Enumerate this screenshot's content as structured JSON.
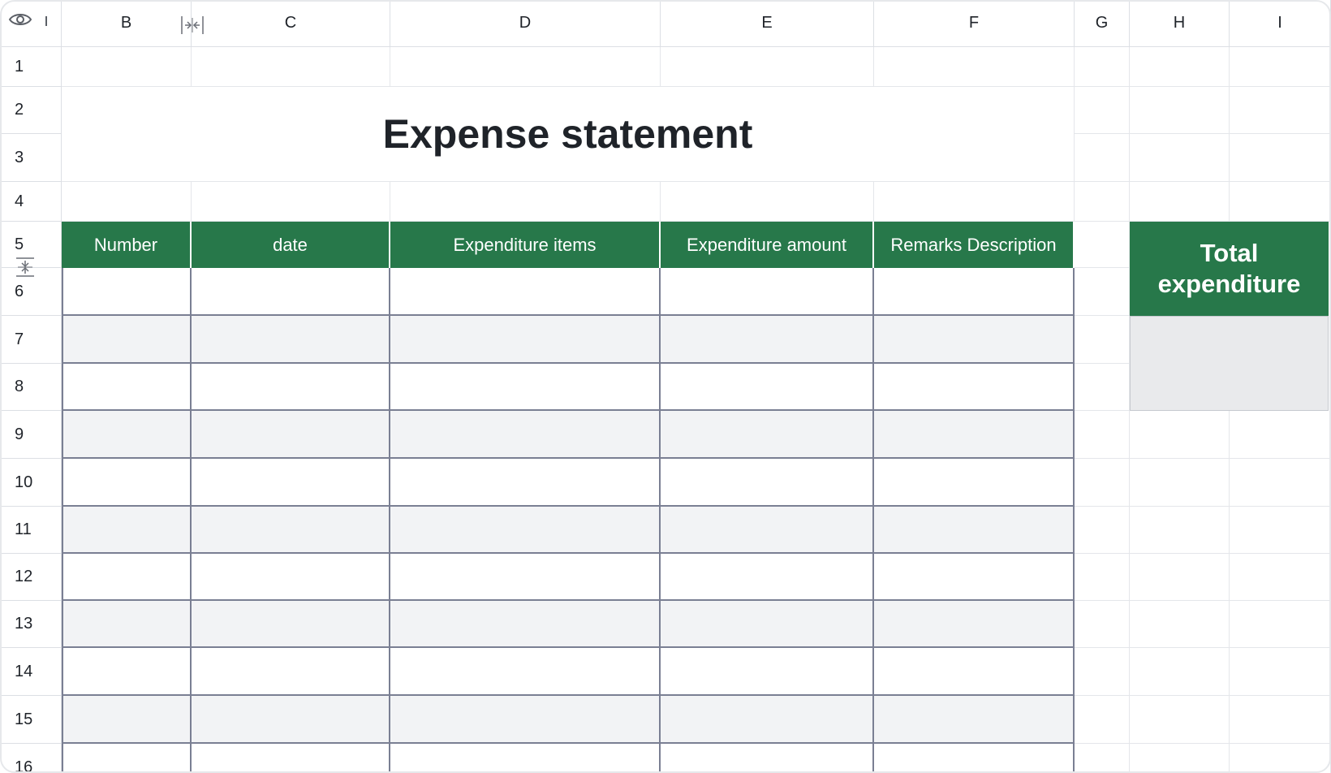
{
  "sheet": {
    "title": "Expense statement",
    "column_headers": [
      "A",
      "B",
      "C",
      "D",
      "E",
      "F",
      "G",
      "H",
      "I"
    ],
    "row_headers": [
      "1",
      "2",
      "3",
      "4",
      "5",
      "6",
      "7",
      "8",
      "9",
      "10",
      "11",
      "12",
      "13",
      "14",
      "15",
      "16"
    ],
    "table_headers": [
      "Number",
      "date",
      "Expenditure items",
      "Expenditure amount",
      "Remarks Description"
    ],
    "total_label": "Total expenditure",
    "colors": {
      "header_green": "#27784a",
      "stripe_gray": "#f2f3f5",
      "grid_line": "#e4e6ea",
      "table_border": "#7a7f93",
      "total_value_bg": "#e9eaec"
    },
    "icons": {
      "view": "eye-icon",
      "column_resize": "column-resize-icon",
      "row_resize": "row-resize-icon"
    }
  }
}
